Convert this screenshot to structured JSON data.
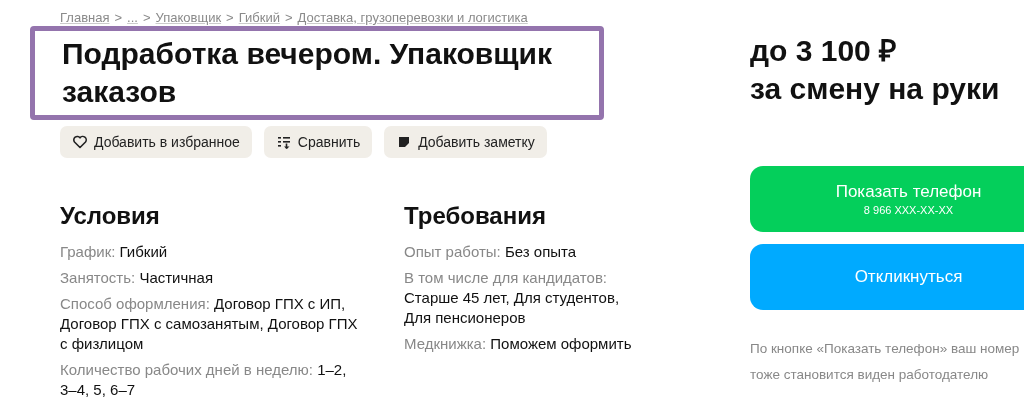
{
  "breadcrumb": [
    {
      "kind": "link",
      "text": "Главная"
    },
    {
      "kind": "separator",
      "text": ">"
    },
    {
      "kind": "link",
      "text": "..."
    },
    {
      "kind": "separator",
      "text": ">"
    },
    {
      "kind": "link",
      "text": "Упаковщик"
    },
    {
      "kind": "separator",
      "text": ">"
    },
    {
      "kind": "link",
      "text": "Гибкий"
    },
    {
      "kind": "separator",
      "text": ">"
    },
    {
      "kind": "link",
      "text": "Доставка, грузоперевозки и логистика"
    }
  ],
  "title": "Подработка вечером. Упаковщик заказов",
  "title_highlighted": true,
  "actions": [
    {
      "label": "Добавить в избранное"
    },
    {
      "label": "Сравнить"
    },
    {
      "label": "Добавить заметку"
    }
  ],
  "sections": [
    {
      "heading": "Условия",
      "items": [
        {
          "label": "График:",
          "value": "Гибкий"
        },
        {
          "label": "Занятость:",
          "value": "Частичная"
        },
        {
          "label": "Способ оформления:",
          "value": "Договор ГПХ с ИП, Договор ГПХ с самозанятым, Договор ГПХ с физлицом"
        },
        {
          "label": "Количество рабочих дней в неделю:",
          "value": "1–2, 3–4, 5, 6–7"
        }
      ]
    },
    {
      "heading": "Требования",
      "items": [
        {
          "label": "Опыт работы:",
          "value": "Без опыта"
        },
        {
          "label": "В том числе для кандидатов:",
          "value": "Старше 45 лет, Для студентов, Для пенсионеров"
        },
        {
          "label": "Медкнижка:",
          "value": "Поможем оформить"
        }
      ]
    }
  ],
  "salary": {
    "amount": "до 3 100 ₽",
    "period": "за смену на руки"
  },
  "phone_button": {
    "label": "Показать телефон",
    "number": "8 966 XXX-XX-XX"
  },
  "respond_button": {
    "label": "Откликнуться"
  },
  "note": "По кнопке «Показать телефон» ваш номер тоже становится виден работодателю"
}
